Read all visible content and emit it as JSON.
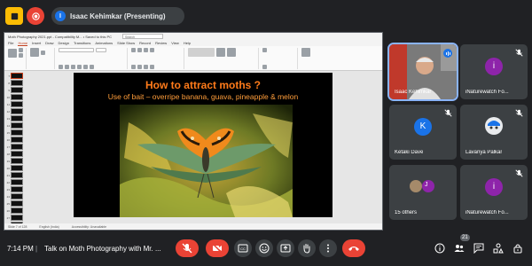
{
  "top": {
    "presenter_initial": "I",
    "presenter_label": "Isaac Kehimkar (Presenting)"
  },
  "powerpoint": {
    "doc_title": "Moth Photography 2021.ppt - Compatibility M... • Saved to this PC",
    "search_placeholder": "Search",
    "menus": [
      "File",
      "Home",
      "Insert",
      "Draw",
      "Design",
      "Transitions",
      "Animations",
      "Slide Show",
      "Record",
      "Review",
      "View",
      "Help"
    ],
    "active_menu": "Home",
    "thumbnail_numbers": [
      "7",
      "8",
      "9",
      "10",
      "11",
      "12",
      "13",
      "14",
      "15",
      "16",
      "17",
      "18",
      "19",
      "20",
      "21",
      "22",
      "23",
      "24",
      "25",
      "26",
      "27",
      "28"
    ],
    "status_slide": "Slide 7 of 128",
    "status_lang": "English (India)",
    "status_access": "Accessibility: Unavailable"
  },
  "slide": {
    "title": "How to attract moths ?",
    "subtitle": "Use of bait – overripe banana, guava, pineapple & melon"
  },
  "participants": [
    {
      "name": "Isaac Kehimkar",
      "initial": "",
      "color": "#6b6b6b",
      "speaking": true
    },
    {
      "name": "iNaturewatch Fo...",
      "initial": "i",
      "color": "#8e24aa",
      "speaking": false
    },
    {
      "name": "Ketaki Dave",
      "initial": "K",
      "color": "#1a73e8",
      "speaking": false
    },
    {
      "name": "Lavanya Palkar",
      "initial": "",
      "color": "#e8eaed",
      "speaking": false
    },
    {
      "name": "15 others",
      "initial": "J",
      "color": "#8e24aa",
      "speaking": false
    },
    {
      "name": "iNaturewatch Fo...",
      "initial": "i",
      "color": "#8e24aa",
      "speaking": false
    }
  ],
  "bottom": {
    "time": "7:14 PM",
    "meeting_title": "Talk on Moth Photography with Mr. ...",
    "participant_count": "21"
  },
  "colors": {
    "background": "#202124",
    "tile": "#3c4043",
    "danger": "#ea4335",
    "accent": "#8ab4f8",
    "slide_title": "#ff7b1a"
  },
  "icons": {
    "record": "record-icon",
    "present_badge": "avatar-i",
    "mic_off": "mic-off-icon",
    "camera_off": "camera-off-icon",
    "captions": "captions-icon",
    "emoji": "emoji-icon",
    "present": "present-icon",
    "raise_hand": "raise-hand-icon",
    "more": "more-vert-icon",
    "end_call": "end-call-icon",
    "info": "info-icon",
    "people": "people-icon",
    "chat": "chat-icon",
    "activities": "activities-icon",
    "lock": "host-controls-icon"
  }
}
